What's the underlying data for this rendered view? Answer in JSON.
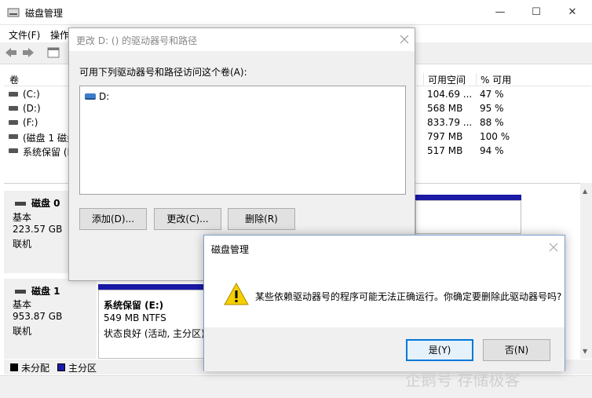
{
  "window": {
    "title": "磁盘管理",
    "controls": [
      "—",
      "☐",
      "✕"
    ]
  },
  "menu": [
    "文件(F)",
    "操作"
  ],
  "volume_list": {
    "headers": [
      "卷",
      "可用空间",
      "% 可用"
    ],
    "rows": [
      {
        "name": "(C:)",
        "free": "104.69 ...",
        "pct": "47 %"
      },
      {
        "name": "(D:)",
        "free": "568 MB",
        "pct": "95 %"
      },
      {
        "name": "(F:)",
        "free": "833.79 ...",
        "pct": "88 %"
      },
      {
        "name": "(磁盘 1 磁盘",
        "free": "797 MB",
        "pct": "100 %"
      },
      {
        "name": "系统保留 (E",
        "free": "517 MB",
        "pct": "94 %"
      }
    ]
  },
  "disks": [
    {
      "name": "磁盘 0",
      "type": "基本",
      "size": "223.57 GB",
      "status": "联机"
    },
    {
      "name": "磁盘 1",
      "type": "基本",
      "size": "953.87 GB",
      "status": "联机",
      "partition": {
        "name": "系统保留 (E:)",
        "size": "549 MB NTFS",
        "status": "状态良好 (活动, 主分区)"
      }
    }
  ],
  "legend": [
    {
      "label": "未分配",
      "color": "#000000"
    },
    {
      "label": "主分区",
      "color": "#1a1aa6"
    }
  ],
  "change_dialog": {
    "title": "更改 D: () 的驱动器号和路径",
    "prompt": "可用下列驱动器号和路径访问这个卷(A):",
    "items": [
      "D:"
    ],
    "buttons": {
      "add": "添加(D)...",
      "change": "更改(C)...",
      "remove": "删除(R)"
    }
  },
  "confirm_dialog": {
    "title": "磁盘管理",
    "message": "某些依赖驱动器号的程序可能无法正确运行。你确定要删除此驱动器号吗?",
    "buttons": {
      "yes": "是(Y)",
      "no": "否(N)"
    },
    "icon": "warning-icon"
  },
  "watermark": "企鹅号 存储极客",
  "colors": {
    "primary_partition": "#1a1aa6",
    "accent": "#0078d7",
    "warning": "#f5d000"
  }
}
